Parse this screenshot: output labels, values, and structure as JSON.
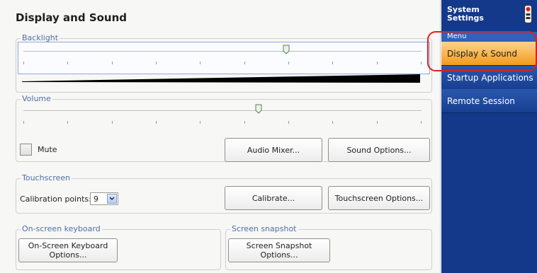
{
  "title": "Display and Sound",
  "backlight": {
    "label": "Backlight",
    "value_fraction": 0.66
  },
  "volume": {
    "label": "Volume",
    "value_fraction": 0.59
  },
  "mute": {
    "label": "Mute",
    "checked": false
  },
  "buttons": {
    "audio_mixer": "Audio Mixer...",
    "sound_options": "Sound Options...",
    "calibrate": "Calibrate...",
    "touchscreen_options": "Touchscreen Options...",
    "osk_options": "On-Screen Keyboard Options...",
    "snapshot_options": "Screen Snapshot Options..."
  },
  "touchscreen": {
    "label": "Touchscreen",
    "calibration_label": "Calibration points:",
    "calibration_value": "9"
  },
  "osk": {
    "label": "On-screen keyboard"
  },
  "snapshot": {
    "label": "Screen snapshot"
  },
  "sidebar": {
    "title": "System Settings",
    "menu_label": "Menu",
    "items": [
      {
        "label": "Display & Sound",
        "active": true
      },
      {
        "label": "Startup Applications",
        "active": false
      },
      {
        "label": "Remote Session",
        "active": false
      }
    ]
  },
  "colors": {
    "accent": "#14398a",
    "active_item": "#f29a1c",
    "highlight_ring": "#d7231f"
  }
}
